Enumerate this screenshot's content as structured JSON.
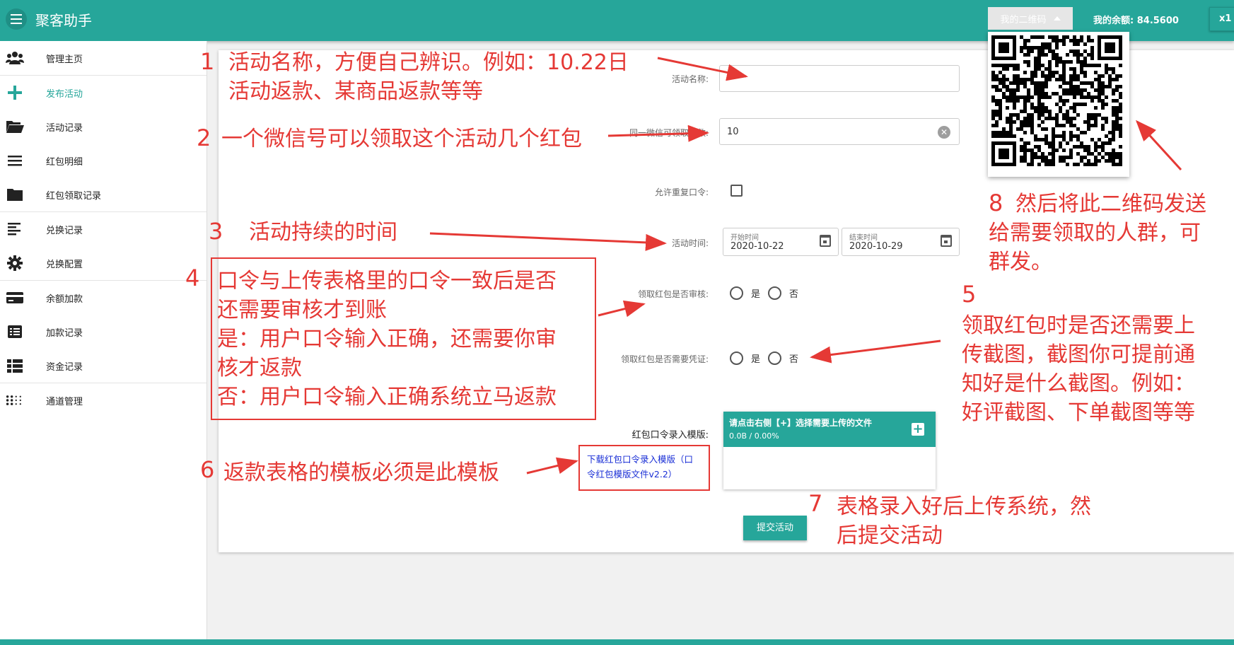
{
  "header": {
    "app_title": "聚客助手",
    "qr_button_label": "我的二维码",
    "balance": "我的余额: 84.5600",
    "right_button_label": "x1"
  },
  "sidebar": {
    "items": [
      {
        "label": "管理主页",
        "icon": "users-icon"
      },
      {
        "label": "发布活动",
        "icon": "plus-icon",
        "active": true
      },
      {
        "label": "活动记录",
        "icon": "folder-open-icon"
      },
      {
        "label": "红包明细",
        "icon": "list-icon"
      },
      {
        "label": "红包领取记录",
        "icon": "folder-icon"
      },
      {
        "label": "兑换记录",
        "icon": "align-left-icon"
      },
      {
        "label": "兑换配置",
        "icon": "gear-icon"
      },
      {
        "label": "余额加款",
        "icon": "credit-card-icon"
      },
      {
        "label": "加款记录",
        "icon": "list-alt-icon"
      },
      {
        "label": "资金记录",
        "icon": "th-list-icon"
      },
      {
        "label": "通道管理",
        "icon": "dots-grid-icon"
      }
    ]
  },
  "form": {
    "name_label": "活动名称:",
    "name_value": "",
    "count_label": "同一微信可领取个数:",
    "count_value": "10",
    "repeat_label": "允许重复口令:",
    "time_label": "活动时间:",
    "start_label": "开始时间",
    "start_value": "2020-10-22",
    "end_label": "结束时间",
    "end_value": "2020-10-29",
    "review_label": "领取红包是否审核:",
    "proof_label": "领取红包是否需要凭证:",
    "yes": "是",
    "no": "否",
    "template_label": "红包口令录入模版:",
    "template_link": "下载红包口令录入模版（口令红包模版文件v2.2）",
    "upload_title": "请点击右侧【+】选择需要上传的文件",
    "upload_progress": "0.0B / 0.00%",
    "submit_label": "提交活动"
  },
  "annotations": {
    "n1": "1",
    "a1": "活动名称，方便自己辨识。例如：10.22日\n活动返款、某商品返款等等",
    "n2": "2",
    "a2": "一个微信号可以领取这个活动几个红包",
    "n3": "3",
    "a3": "活动持续的时间",
    "n4": "4",
    "a4": "口令与上传表格里的口令一致后是否\n还需要审核才到账\n是：用户口令输入正确，还需要你审\n核才返款\n否：用户口令输入正确系统立马返款",
    "n5": "5",
    "a5": "领取红包时是否还需要上\n传截图，截图你可提前通\n知好是什么截图。例如：\n好评截图、下单截图等等",
    "n6": "6",
    "a6": "返款表格的模板必须是此模板",
    "n7": "7",
    "a7": "表格录入好后上传系统，然\n后提交活动",
    "n8": "8",
    "a8": "然后将此二维码发送\n给需要领取的人群，可\n群发。"
  },
  "colors": {
    "primary": "#26a69a",
    "annotation": "#e53935",
    "link": "#1a2fd6"
  }
}
